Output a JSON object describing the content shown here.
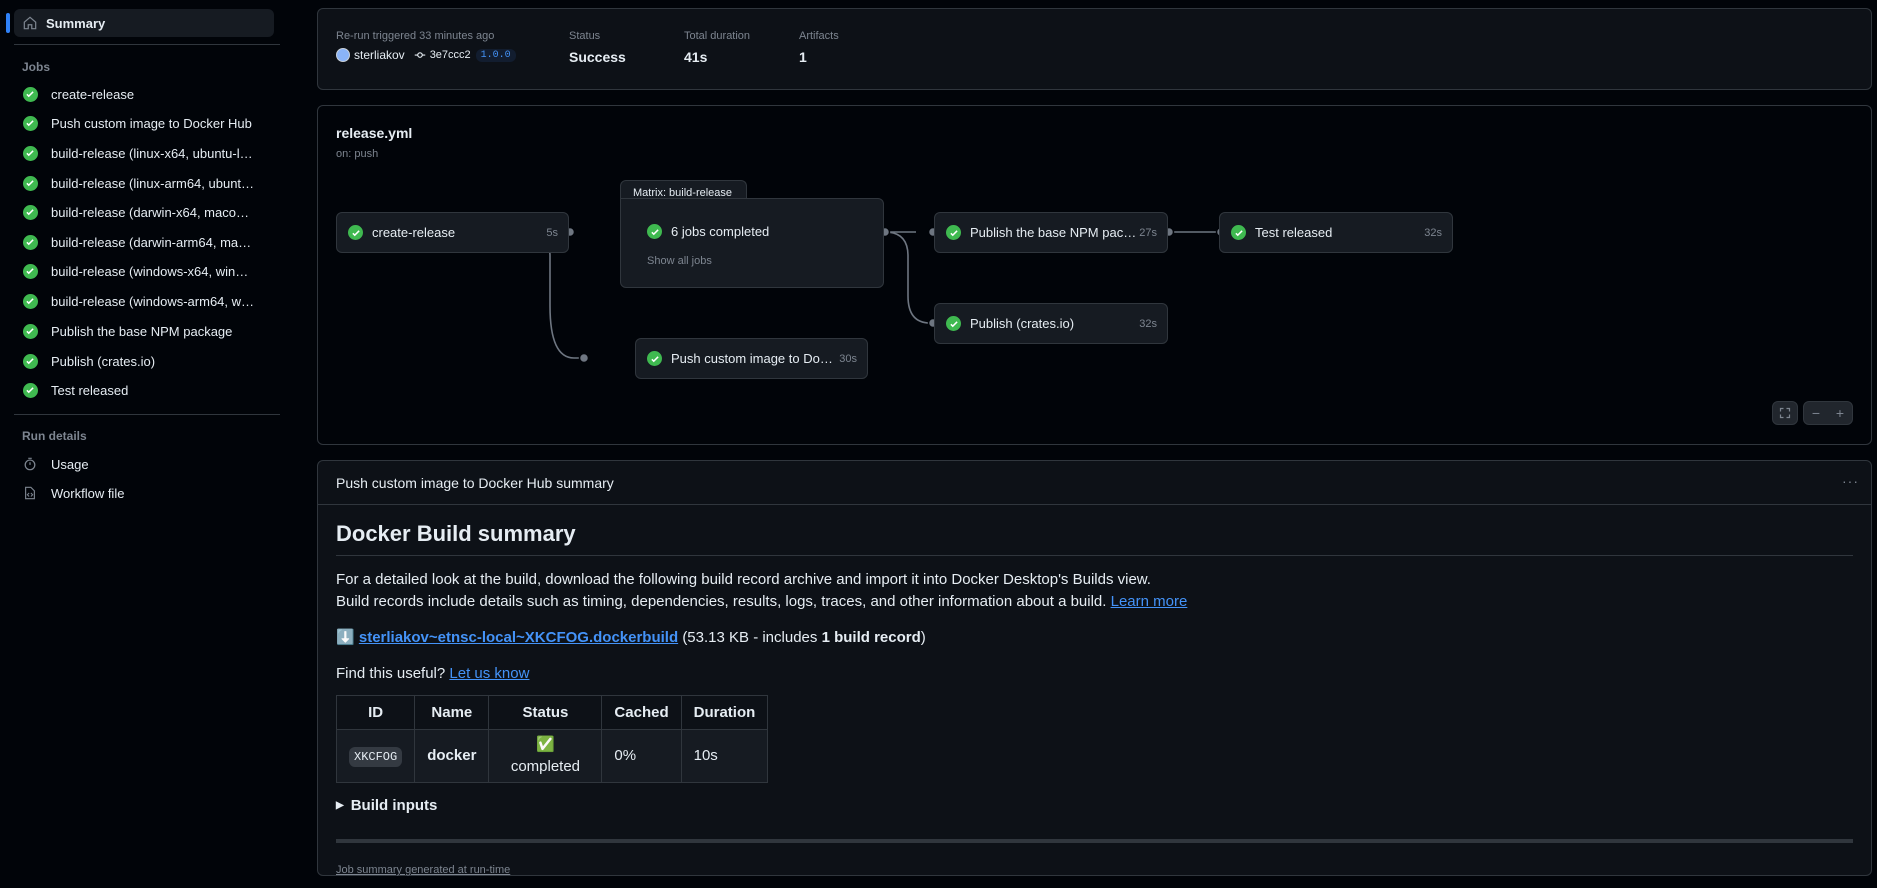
{
  "sidebar": {
    "summary_label": "Summary",
    "jobs_heading": "Jobs",
    "jobs": [
      {
        "label": "create-release"
      },
      {
        "label": "Push custom image to Docker Hub"
      },
      {
        "label": "build-release (linux-x64, ubuntu-l…"
      },
      {
        "label": "build-release (linux-arm64, ubunt…"
      },
      {
        "label": "build-release (darwin-x64, maco…"
      },
      {
        "label": "build-release (darwin-arm64, ma…"
      },
      {
        "label": "build-release (windows-x64, win…"
      },
      {
        "label": "build-release (windows-arm64, w…"
      },
      {
        "label": "Publish the base NPM package"
      },
      {
        "label": "Publish (crates.io)"
      },
      {
        "label": "Test released"
      }
    ],
    "run_details_heading": "Run details",
    "usage_label": "Usage",
    "workflow_file_label": "Workflow file"
  },
  "run": {
    "trigger_text": "Re-run triggered 33 minutes ago",
    "actor": "sterliakov",
    "commit": "3e7ccc2",
    "tag": "1.0.0",
    "status_label": "Status",
    "status_value": "Success",
    "duration_label": "Total duration",
    "duration_value": "41s",
    "artifacts_label": "Artifacts",
    "artifacts_value": "1"
  },
  "graph": {
    "title": "release.yml",
    "trigger": "on: push",
    "jobs": {
      "create_release": {
        "name": "create-release",
        "duration": "5s"
      },
      "push_image": {
        "name": "Push custom image to Doc…",
        "duration": "30s"
      },
      "publish_npm": {
        "name": "Publish the base NPM pack…",
        "duration": "27s"
      },
      "publish_crates": {
        "name": "Publish (crates.io)",
        "duration": "32s"
      },
      "test_released": {
        "name": "Test released",
        "duration": "32s"
      }
    },
    "matrix": {
      "title": "Matrix: build-release",
      "status": "6 jobs completed",
      "show_all": "Show all jobs"
    }
  },
  "summary": {
    "header": "Push custom image to Docker Hub summary",
    "heading": "Docker Build summary",
    "para1": "For a detailed look at the build, download the following build record archive and import it into Docker Desktop's Builds view.",
    "para2": "Build records include details such as timing, dependencies, results, logs, traces, and other information about a build.",
    "learn_more": "Learn more",
    "download_emoji": "⬇️",
    "file_link": "sterliakov~etnsc-local~XKCFOG.dockerbuild",
    "file_info_pre": "(53.13 KB - includes ",
    "file_info_bold": "1 build record",
    "file_info_post": ")",
    "useful_q": "Find this useful?",
    "let_us_know": "Let us know",
    "table": {
      "headers": [
        "ID",
        "Name",
        "Status",
        "Cached",
        "Duration"
      ],
      "row": {
        "id": "XKCFOG",
        "name": "docker",
        "status": "✅ completed",
        "cached": "0%",
        "duration": "10s"
      }
    },
    "build_inputs": "Build inputs",
    "footer": "Job summary generated at run-time"
  }
}
